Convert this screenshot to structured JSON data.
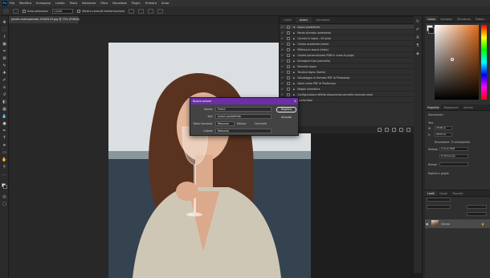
{
  "menu": {
    "logo": "Ps",
    "items": [
      "File",
      "Modifica",
      "Immagine",
      "Livello",
      "Testo",
      "Selezione",
      "Filtro",
      "Visualizza",
      "Plugin",
      "Finestra",
      "Aiuto"
    ]
  },
  "options_bar": {
    "label1": "Auto-seleziona:",
    "select1": "Livello",
    "label2": "Mostra controlli trasformazione"
  },
  "document": {
    "tab_title": "pexels-mahsapshoto-19465143.jpg @ 25% (RGB/8) ×"
  },
  "actions_panel": {
    "tabs": [
      "Livelli",
      "Azioni",
      "Commenti"
    ],
    "active_tab": "Azioni",
    "rows": [
      "Azioni predefinite",
      "Bordo sfumato (selezione)",
      "Cornice in legno - 50 pixel",
      "Ombra proiettata (testo)",
      "Riflesso in acqua (testo)",
      "Canale personalizzato RGB in scala di grigio",
      "Immagine fusa (pennello)",
      "Pennello legno",
      "Tendina legno (livello)",
      "Salvataggio in formato PDF di Photoshop",
      "Salva come PDF di Photoshop",
      "Mappa sfumatura",
      "Configurazione effetto dissolvenza pennello mescola colori",
      "Livello falso"
    ]
  },
  "dialog": {
    "title": "Nuova azione",
    "name_label": "Nome:",
    "name_value": "Ferrul",
    "set_label": "Set:",
    "set_value": "Azioni predefinite",
    "fkey_label": "Tasto funzione:",
    "fkey_value": "Nessuno",
    "shift_label": "Maiusc",
    "ctrl_label": "Controllo",
    "color_label": "Colore:",
    "color_value": "Nessuno",
    "record_button": "Registra",
    "cancel_button": "Annulla"
  },
  "color_panel": {
    "tabs": [
      "Colore",
      "Campioni",
      "Sfumature",
      "Pattern"
    ],
    "fg": "#f2f2f2",
    "bg": "#1b1b1b",
    "hue_color": "#e06a18"
  },
  "properties_panel": {
    "tabs": [
      "Proprietà",
      "Regolazioni",
      "Librerie"
    ],
    "doc_label": "Documento",
    "canvas_label": "Tela",
    "w_value": "2048 px",
    "h_value": "4043 px",
    "res_label": "Risoluzione: 72 pixel/pollice",
    "mode_label": "Metodo",
    "mode_value": "Colore RGB",
    "depth_value": "8 bit/canale",
    "fill_label": "Riempi",
    "rulers_label": "Righelli e griglie"
  },
  "layers_panel": {
    "tabs": [
      "Livelli",
      "Canali",
      "Tracciati"
    ],
    "layer_name": "Sfondo"
  }
}
